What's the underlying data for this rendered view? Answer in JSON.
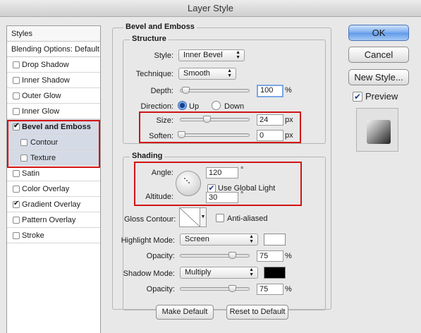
{
  "window": {
    "title": "Layer Style"
  },
  "sidebar": {
    "styles_header": "Styles",
    "blending_header": "Blending Options: Default",
    "items": [
      {
        "label": "Drop Shadow",
        "checked": false
      },
      {
        "label": "Inner Shadow",
        "checked": false
      },
      {
        "label": "Outer Glow",
        "checked": false
      },
      {
        "label": "Inner Glow",
        "checked": false
      },
      {
        "label": "Bevel and Emboss",
        "checked": true
      },
      {
        "label": "Contour",
        "checked": false
      },
      {
        "label": "Texture",
        "checked": false
      },
      {
        "label": "Satin",
        "checked": false
      },
      {
        "label": "Color Overlay",
        "checked": false
      },
      {
        "label": "Gradient Overlay",
        "checked": true
      },
      {
        "label": "Pattern Overlay",
        "checked": false
      },
      {
        "label": "Stroke",
        "checked": false
      }
    ]
  },
  "bevel": {
    "title": "Bevel and Emboss",
    "structure_title": "Structure",
    "style_label": "Style:",
    "style_value": "Inner Bevel",
    "technique_label": "Technique:",
    "technique_value": "Smooth",
    "depth_label": "Depth:",
    "depth_value": "100",
    "depth_unit": "%",
    "direction_label": "Direction:",
    "direction_up": "Up",
    "direction_down": "Down",
    "size_label": "Size:",
    "size_value": "24",
    "size_unit": "px",
    "soften_label": "Soften:",
    "soften_value": "0",
    "soften_unit": "px"
  },
  "shading": {
    "title": "Shading",
    "angle_label": "Angle:",
    "angle_value": "120",
    "angle_unit": "°",
    "global_light_label": "Use Global Light",
    "altitude_label": "Altitude:",
    "altitude_value": "30",
    "altitude_unit": "°",
    "gloss_label": "Gloss Contour:",
    "anti_aliased_label": "Anti-aliased",
    "highlight_mode_label": "Highlight Mode:",
    "highlight_mode_value": "Screen",
    "highlight_color": "#ffffff",
    "highlight_opacity_label": "Opacity:",
    "highlight_opacity_value": "75",
    "highlight_opacity_unit": "%",
    "shadow_mode_label": "Shadow Mode:",
    "shadow_mode_value": "Multiply",
    "shadow_color": "#000000",
    "shadow_opacity_label": "Opacity:",
    "shadow_opacity_value": "75",
    "shadow_opacity_unit": "%"
  },
  "footer": {
    "make_default": "Make Default",
    "reset_default": "Reset to Default"
  },
  "actions": {
    "ok": "OK",
    "cancel": "Cancel",
    "new_style": "New Style...",
    "preview_label": "Preview",
    "preview_checked": true
  },
  "colors": {
    "accent": "#5f9aea",
    "highlight_box": "#d11414",
    "selected_row": "#d5dbe6"
  }
}
